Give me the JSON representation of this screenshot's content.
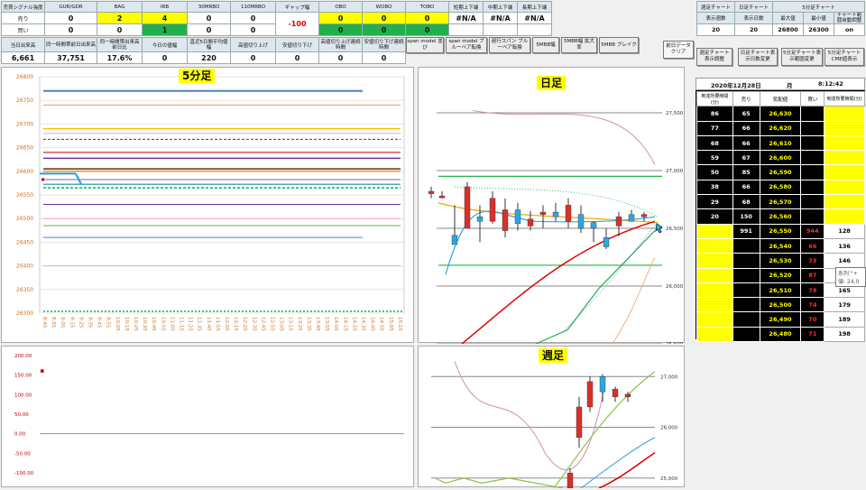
{
  "top_table": {
    "headers": [
      "売買シグナル強度",
      "GUR/GDR",
      "BAG",
      "IRB",
      "30MRBO",
      "110MRBO",
      "ギャップ幅",
      "OBO",
      "WOBO",
      "TOBO",
      "短期上下端",
      "中期上下端",
      "長期上下端"
    ],
    "rows": [
      {
        "label": "売り",
        "values": [
          "0",
          "2",
          "4",
          "0",
          "0",
          "-100",
          "0",
          "0",
          "0",
          "#N/A",
          "#N/A",
          "#N/A"
        ]
      },
      {
        "label": "買い",
        "values": [
          "0",
          "0",
          "1",
          "0",
          "0",
          "",
          "0",
          "0",
          "0",
          "",
          "",
          ""
        ]
      }
    ]
  },
  "second_table": {
    "headers": [
      "当日出来高",
      "同一時間帯前日出来高",
      "同一時間帯出来高前日比",
      "今日の値幅",
      "直近5日間平均値幅",
      "高値切り上げ",
      "安値切り下げ",
      "高値切り上げ連続時間",
      "安値切り下げ連続時間"
    ],
    "values": [
      "6,661",
      "37,751",
      "17.6%",
      "0",
      "220",
      "0",
      "0",
      "0",
      "0"
    ]
  },
  "model_buttons": [
    "span model 並び",
    "span model ブルーベア転換",
    "遅行スパン ブルーベア転換",
    "5MBB幅",
    "5MBB幅 拡大率",
    "5MBB ブレイク"
  ],
  "clear_button": "前日データクリア",
  "right_table": {
    "headers": [
      "週足チャート",
      "日足チャート",
      "5分足チャート"
    ],
    "sub_headers": [
      "表示週数",
      "表示日数",
      "最大値",
      "最小値",
      "チャート範囲自動調整"
    ],
    "values": [
      "20",
      "20",
      "26800",
      "26300",
      "on"
    ]
  },
  "chart_buttons": [
    "週足チャート表示調整",
    "日足チャート表示日数変更",
    "5分足チャート表示範囲変更",
    "5分足チャートCME値表示"
  ],
  "orderbook": {
    "date": "2020年12月28日",
    "label": "月",
    "time": "8:12:42",
    "headers": [
      "到達所要時間(分)",
      "売り",
      "気配値",
      "買い",
      "到達所要時間(分)"
    ],
    "rows": [
      [
        "86",
        "65",
        "26,630",
        "",
        ""
      ],
      [
        "77",
        "66",
        "26,620",
        "",
        ""
      ],
      [
        "68",
        "66",
        "26,610",
        "",
        ""
      ],
      [
        "59",
        "67",
        "26,600",
        "",
        ""
      ],
      [
        "50",
        "85",
        "26,590",
        "",
        ""
      ],
      [
        "38",
        "66",
        "26,580",
        "",
        ""
      ],
      [
        "29",
        "68",
        "26,570",
        "",
        ""
      ],
      [
        "20",
        "150",
        "26,560",
        "",
        ""
      ],
      [
        "",
        "991",
        "26,550",
        "944",
        "128"
      ],
      [
        "",
        "",
        "26,540",
        "66",
        "136"
      ],
      [
        "",
        "",
        "26,530",
        "73",
        "146"
      ],
      [
        "",
        "",
        "26,520",
        "87",
        "155"
      ],
      [
        "",
        "",
        "26,510",
        "78",
        "165"
      ],
      [
        "",
        "",
        "26,500",
        "74",
        "179"
      ],
      [
        "",
        "",
        "26,490",
        "70",
        "189"
      ],
      [
        "",
        "",
        "26,480",
        "71",
        "198"
      ]
    ]
  },
  "tooltip": {
    "line1": "系列 \"+",
    "line2": "値: 24,0"
  },
  "chart_5min": {
    "title": "5分足",
    "yticks": [
      "26800",
      "26750",
      "26700",
      "26650",
      "26600",
      "26550",
      "26500",
      "26450",
      "26400",
      "26350",
      "26300"
    ],
    "xticks": [
      "8:45",
      "8:55",
      "9:05",
      "9:15",
      "9:25",
      "9:35",
      "9:45",
      "9:55",
      "10:05",
      "10:15",
      "10:25",
      "10:35",
      "10:45",
      "10:55",
      "11:05",
      "11:15",
      "11:25",
      "11:35",
      "11:45",
      "11:55",
      "12:05",
      "12:15",
      "12:25",
      "12:35",
      "12:45",
      "12:55",
      "13:05",
      "13:15",
      "13:25",
      "13:35",
      "13:45",
      "13:55",
      "14:05",
      "14:15",
      "14:25",
      "14:35",
      "14:45",
      "14:55",
      "15:05",
      "15:15"
    ]
  },
  "chart_lower": {
    "yticks": [
      "200.00",
      "150.00",
      "100.00",
      "50.00",
      "0.00",
      "-50.00",
      "-100.00"
    ]
  },
  "chart_daily": {
    "title": "日足",
    "yticks": [
      "27,500",
      "27,000",
      "26,500",
      "26,000",
      "25,500"
    ]
  },
  "chart_weekly": {
    "title": "週足",
    "yticks": [
      "27,000",
      "26,000",
      "25,000"
    ]
  },
  "colors": {
    "accent_yellow": "#ffff00",
    "accent_green": "#22b04c",
    "candle_up": "#2ba7e0",
    "candle_down": "#d9302a"
  }
}
